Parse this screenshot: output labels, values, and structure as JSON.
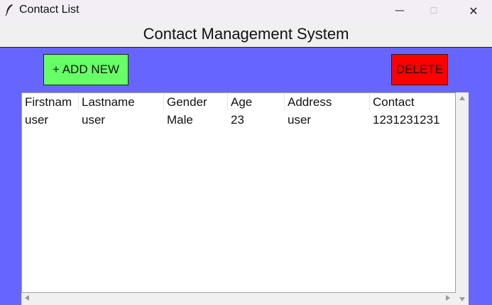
{
  "window": {
    "title": "Contact List",
    "icon": "feather-icon",
    "controls": {
      "minimize": "—",
      "maximize": "☐",
      "close": "✕"
    }
  },
  "header": {
    "title": "Contact Management System"
  },
  "toolbar": {
    "add_label": "+ ADD NEW",
    "delete_label": "DELETE",
    "add_color": "#66ff66",
    "delete_color": "#ff0000"
  },
  "colors": {
    "background": "#6666ff",
    "header_bg": "#f0f0f0"
  },
  "table": {
    "columns": [
      "Firstnam",
      "Lastname",
      "Gender",
      "Age",
      "Address",
      "Contact"
    ],
    "rows": [
      [
        "user",
        "user",
        "Male",
        "23",
        "user",
        "1231231231"
      ]
    ]
  }
}
